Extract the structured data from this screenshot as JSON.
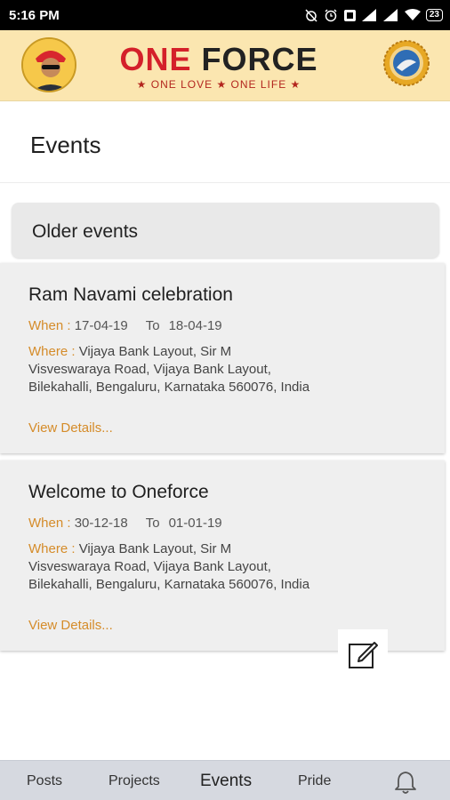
{
  "status_bar": {
    "time": "5:16 PM",
    "battery": "23",
    "icons": [
      "alarm-off-icon",
      "alarm-icon",
      "sim-icon",
      "signal-icon",
      "signal-icon",
      "wifi-icon",
      "battery-icon"
    ]
  },
  "header": {
    "logo_word1": "ONE",
    "logo_word2": "FORCE",
    "tagline": "★ ONE LOVE ★ ONE LIFE ★",
    "colors": {
      "background": "#fbe6b0",
      "brand_red": "#d4202a",
      "accent": "#d58c2a"
    }
  },
  "page": {
    "title": "Events"
  },
  "section": {
    "label": "Older events"
  },
  "events": [
    {
      "title": "Ram Navami celebration",
      "when_label": "When : ",
      "start": "17-04-19",
      "to_label": "To",
      "end": "18-04-19",
      "where_label": "Where : ",
      "where": "Vijaya Bank Layout, Sir M Visveswaraya Road, Vijaya Bank Layout, Bilekahalli, Bengaluru, Karnataka 560076, India",
      "details_label": "View Details..."
    },
    {
      "title": "Welcome to Oneforce",
      "when_label": "When : ",
      "start": "30-12-18",
      "to_label": "To",
      "end": "01-01-19",
      "where_label": "Where : ",
      "where": "Vijaya Bank Layout, Sir M Visveswaraya Road, Vijaya Bank Layout, Bilekahalli, Bengaluru, Karnataka 560076, India",
      "details_label": "View Details..."
    }
  ],
  "nav": {
    "items": [
      "Posts",
      "Projects",
      "Events",
      "Pride"
    ],
    "active": "Events"
  }
}
